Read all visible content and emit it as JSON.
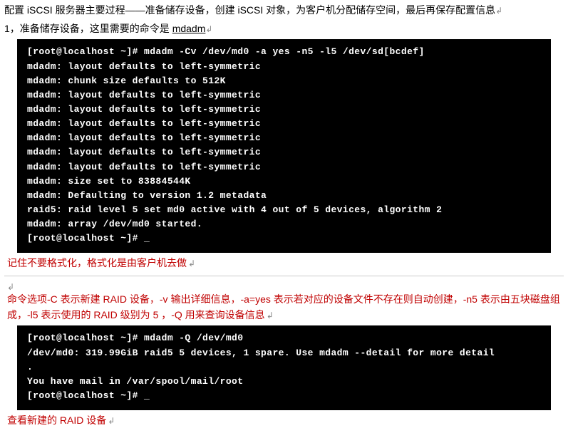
{
  "intro": {
    "line1": "配置 iSCSI 服务器主要过程——准备储存设备，创建 iSCSI 对象，为客户机分配储存空间，最后再保存配置信息",
    "marker1": "↲",
    "line2_prefix": "1，准备储存设备，这里需要的命令是 ",
    "line2_cmd": "mdadm",
    "marker2": "↲"
  },
  "terminal1": "[root@localhost ~]# mdadm -Cv /dev/md0 -a yes -n5 -l5 /dev/sd[bcdef]\nmdadm: layout defaults to left-symmetric\nmdadm: chunk size defaults to 512K\nmdadm: layout defaults to left-symmetric\nmdadm: layout defaults to left-symmetric\nmdadm: layout defaults to left-symmetric\nmdadm: layout defaults to left-symmetric\nmdadm: layout defaults to left-symmetric\nmdadm: layout defaults to left-symmetric\nmdadm: size set to 83884544K\nmdadm: Defaulting to version 1.2 metadata\nraid5: raid level 5 set md0 active with 4 out of 5 devices, algorithm 2\nmdadm: array /dev/md0 started.\n[root@localhost ~]# _",
  "annot1": {
    "text": "记住不要格式化，格式化是由客户机去做",
    "marker": "↲"
  },
  "blank_marker": "↲",
  "annot2": {
    "text": "命令选项-C 表示新建 RAID 设备，-v 输出详细信息，-a=yes 表示若对应的设备文件不存在则自动创建，-n5 表示由五块磁盘组成，-l5 表示使用的 RAID 级别为 5 ，-Q 用来查询设备信息",
    "marker": "↲"
  },
  "terminal2": "[root@localhost ~]# mdadm -Q /dev/md0\n/dev/md0: 319.99GiB raid5 5 devices, 1 spare. Use mdadm --detail for more detail\n.\nYou have mail in /var/spool/mail/root\n[root@localhost ~]# _",
  "annot3": {
    "text": "查看新建的 RAID 设备",
    "marker": "↲"
  }
}
